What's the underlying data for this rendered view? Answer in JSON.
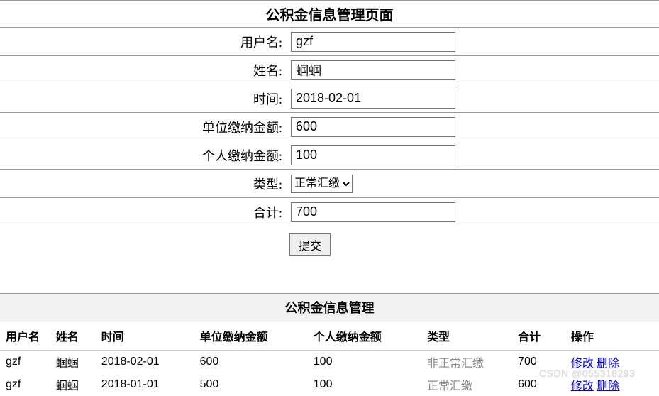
{
  "form": {
    "title": "公积金信息管理页面",
    "labels": {
      "username": "用户名:",
      "name": "姓名:",
      "date": "时间:",
      "unit_amount": "单位缴纳金额:",
      "personal_amount": "个人缴纳金额:",
      "type": "类型:",
      "total": "合计:"
    },
    "values": {
      "username": "gzf",
      "name": "蝈蝈",
      "date": "2018-02-01",
      "unit_amount": "600",
      "personal_amount": "100",
      "type": "正常汇缴",
      "total": "700"
    },
    "submit_label": "提交"
  },
  "list": {
    "title": "公积金信息管理",
    "headers": {
      "username": "用户名",
      "name": "姓名",
      "date": "时间",
      "unit_amount": "单位缴纳金额",
      "personal_amount": "个人缴纳金额",
      "type": "类型",
      "total": "合计",
      "ops": "操作"
    },
    "ops": {
      "edit": "修改",
      "delete": "删除"
    },
    "rows": [
      {
        "username": "gzf",
        "name": "蝈蝈",
        "date": "2018-02-01",
        "unit_amount": "600",
        "personal_amount": "100",
        "type": "非正常汇缴",
        "total": "700"
      },
      {
        "username": "gzf",
        "name": "蝈蝈",
        "date": "2018-01-01",
        "unit_amount": "500",
        "personal_amount": "100",
        "type": "正常汇缴",
        "total": "600"
      }
    ]
  },
  "watermark": "CSDN @055318293"
}
